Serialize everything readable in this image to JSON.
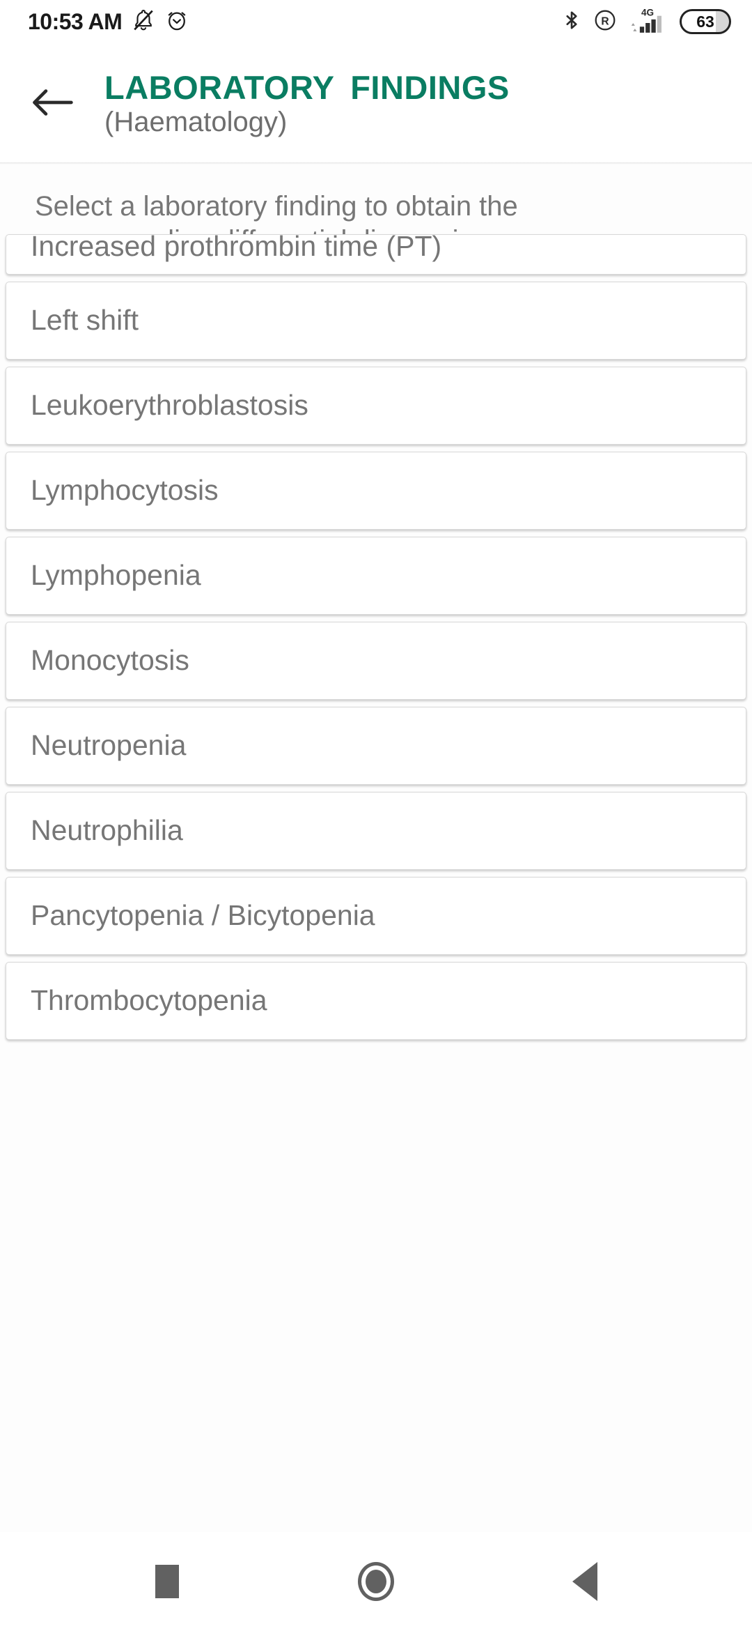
{
  "status_bar": {
    "time": "10:53 AM",
    "left_icons": [
      "mute-bell-icon",
      "alarm-clock-icon"
    ],
    "right_icons": [
      "bluetooth-icon",
      "roaming-icon",
      "signal-4g-icon"
    ],
    "network_type": "4G",
    "battery_level": "63"
  },
  "header": {
    "back_label": "back-arrow",
    "title": "LABORATORY  FINDINGS",
    "subtitle": "(Haematology)",
    "title_color": "#0a7d62",
    "subtitle_color": "#6e6e6e"
  },
  "main": {
    "instruction_line1": "Select a laboratory finding to obtain the",
    "instruction_line2": "corresponding differential diagnosis.",
    "items": [
      {
        "label": "Increased prothrombin time (PT)"
      },
      {
        "label": "Left shift"
      },
      {
        "label": "Leukoerythroblastosis"
      },
      {
        "label": "Lymphocytosis"
      },
      {
        "label": "Lymphopenia"
      },
      {
        "label": "Monocytosis"
      },
      {
        "label": "Neutropenia"
      },
      {
        "label": "Neutrophilia"
      },
      {
        "label": "Pancytopenia / Bicytopenia"
      },
      {
        "label": "Thrombocytopenia"
      }
    ]
  },
  "nav_bar": {
    "recents": "recents-square",
    "home": "home-circle",
    "back": "back-triangle"
  }
}
